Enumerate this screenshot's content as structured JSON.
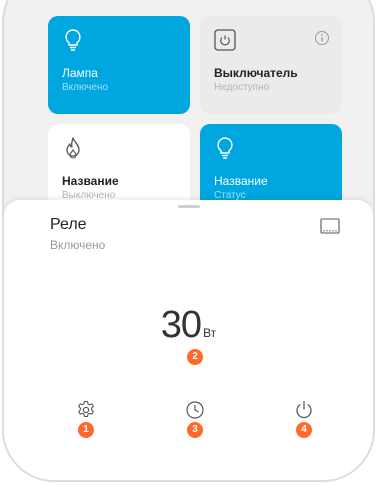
{
  "tiles": [
    {
      "name": "Лампа",
      "status": "Включено",
      "icon": "bulb-icon",
      "style": "blue"
    },
    {
      "name": "Выключатель",
      "status": "Недоступно",
      "icon": "switch-icon",
      "style": "grey",
      "info_icon": "info-icon"
    },
    {
      "name": "Название",
      "status": "Выключено",
      "icon": "flame-icon",
      "style": "white"
    },
    {
      "name": "Название",
      "status": "Статус",
      "icon": "bulb-icon",
      "style": "blue"
    }
  ],
  "sheet": {
    "title": "Реле",
    "status": "Включено",
    "corner_icon": "device-icon",
    "power_value": "30",
    "power_unit": "Вт"
  },
  "toolbar": {
    "items": [
      {
        "icon": "gear-icon",
        "badge": "1"
      },
      {
        "icon": "clock-icon",
        "badge": "3"
      },
      {
        "icon": "power-icon",
        "badge": "4"
      }
    ]
  },
  "power_badge": "2",
  "colors": {
    "accent": "#00a6e0",
    "badge": "#ff6a2a"
  }
}
